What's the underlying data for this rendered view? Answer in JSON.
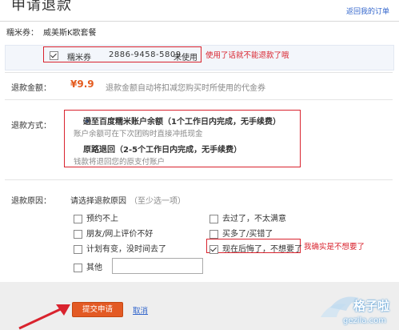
{
  "header": {
    "title": "申请退款",
    "back_link": "返回我的订单"
  },
  "voucher": {
    "label": "糯米券：",
    "name": "威美斯K歌套餐",
    "row_label": "糯米券",
    "code": "2886-9458-5809",
    "status": "未使用",
    "note": "使用了话就不能退款了哦"
  },
  "amount": {
    "label": "退款金额：",
    "value": "¥9.9",
    "hint": "退款金额自动将扣减您购买时所使用的代金券"
  },
  "method": {
    "label": "退款方式：",
    "options": [
      {
        "title": "退至百度糯米账户余额（1个工作日内完成，无手续费）",
        "sub": "账户余额可在下次团购时直接冲抵现金",
        "selected": true
      },
      {
        "title": "原路退回（2-5个工作日内完成，无手续费）",
        "sub": "钱款将退回您的原支付账户",
        "selected": false
      }
    ]
  },
  "reason": {
    "label": "退款原因：",
    "prompt": "请选择退款原因",
    "hint": "（至少选一项）",
    "items": [
      {
        "label": "预约不上",
        "checked": false
      },
      {
        "label": "朋友/网上评价不好",
        "checked": false
      },
      {
        "label": "计划有变，没时间去了",
        "checked": false
      },
      {
        "label": "其他",
        "checked": false
      },
      {
        "label": "去过了，不太满意",
        "checked": false
      },
      {
        "label": "买多了/买错了",
        "checked": false
      },
      {
        "label": "现在后悔了，不想要了",
        "checked": true
      }
    ],
    "annotation": "我确实是不想要了"
  },
  "footer": {
    "submit_label": "提交申请",
    "cancel_label": "取消"
  },
  "watermark": {
    "title": "格子啦",
    "url": "gezila.com"
  },
  "colors": {
    "accent_red": "#d9232e",
    "price_orange": "#e45b1e",
    "submit_orange": "#e35a24",
    "link_blue": "#3366cc"
  }
}
